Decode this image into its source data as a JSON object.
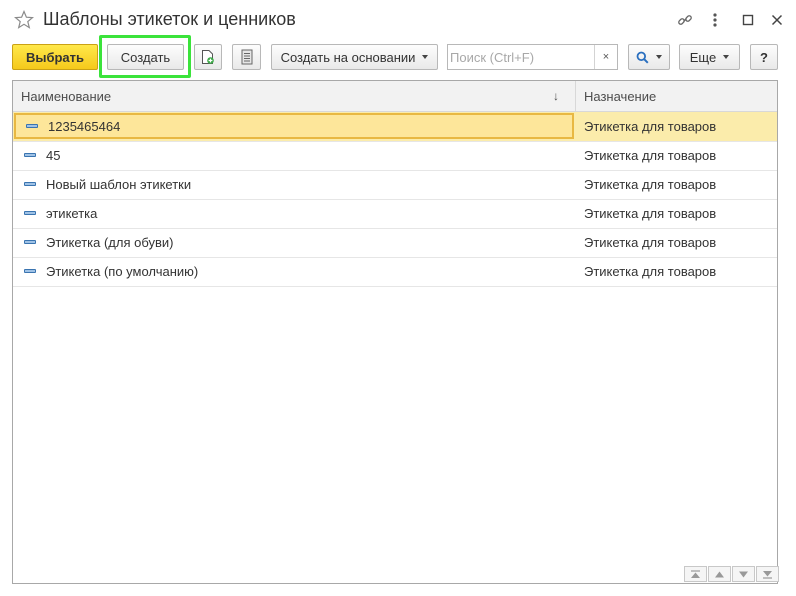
{
  "window": {
    "title": "Шаблоны этикеток и ценников",
    "favorite_icon": "star-outline-icon",
    "controls": [
      "link-icon",
      "more-vertical-icon",
      "maximize-icon",
      "close-icon"
    ]
  },
  "toolbar": {
    "select_label": "Выбрать",
    "create_label": "Создать",
    "create_based_label": "Создать на основании",
    "search_placeholder": "Поиск (Ctrl+F)",
    "search_clear": "×",
    "more_label": "Еще",
    "help_label": "?"
  },
  "table": {
    "columns": [
      {
        "label": "Наименование",
        "sort": "↓"
      },
      {
        "label": "Назначение"
      }
    ],
    "rows": [
      {
        "name": "1235465464",
        "purpose": "Этикетка для товаров",
        "selected": true
      },
      {
        "name": "45",
        "purpose": "Этикетка для товаров"
      },
      {
        "name": "Новый шаблон этикетки",
        "purpose": "Этикетка для товаров"
      },
      {
        "name": "этикетка",
        "purpose": "Этикетка для товаров"
      },
      {
        "name": "Этикетка (для обуви)",
        "purpose": "Этикетка для товаров"
      },
      {
        "name": "Этикетка (по умолчанию)",
        "purpose": "Этикетка для товаров"
      }
    ]
  },
  "colors": {
    "primary_button": "#f5c91b",
    "selected_row": "#fbecab",
    "highlight_frame": "#3be33b"
  }
}
